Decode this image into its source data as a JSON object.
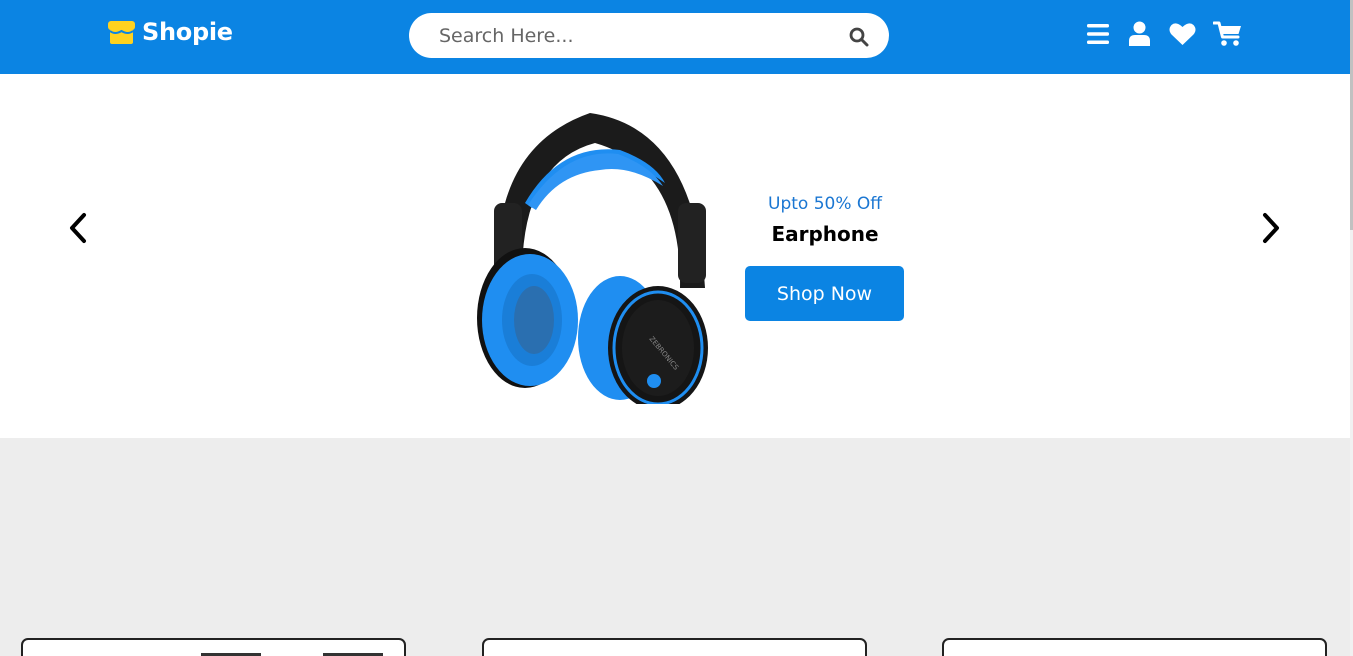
{
  "header": {
    "brand": "Shopie",
    "search_placeholder": "Search Here...",
    "icons": [
      "menu-icon",
      "user-icon",
      "heart-icon",
      "cart-icon"
    ]
  },
  "banner": {
    "offer": "Upto 50% Off",
    "product_name": "Earphone",
    "shop_button": "Shop Now",
    "product_brand_mark": "ZEBRONICS"
  },
  "colors": {
    "primary": "#0b84e3",
    "accent_text": "#1a76d2",
    "logo_yellow": "#ffd21f",
    "background": "#ededed"
  }
}
